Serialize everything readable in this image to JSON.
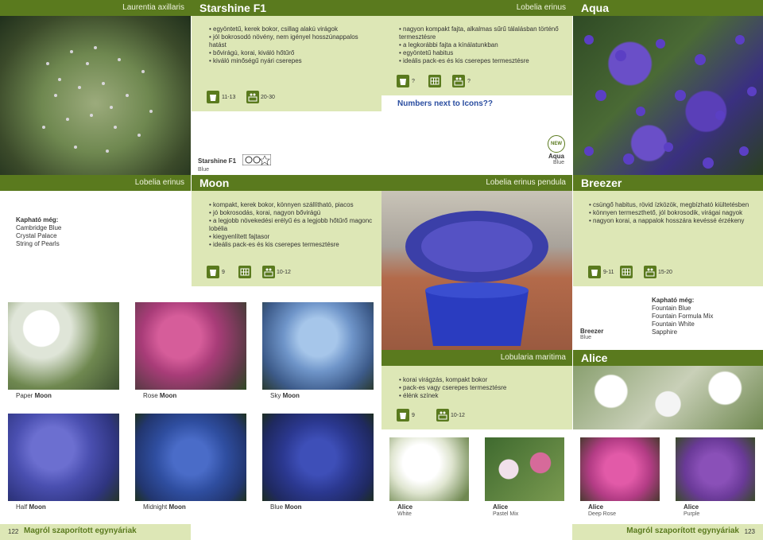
{
  "left_page": {
    "laurentia": {
      "sci": "Laurentia axillaris"
    },
    "starshine": {
      "name": "Starshine F1",
      "bullets": [
        "egyöntetű, kerek bokor, csillag alakú virágok",
        "jól bokrosodó növény, nem igényel hosszúnappalos hatást",
        "bővirágú, korai, kiváló hőtűrő",
        "kiváló minőségű nyári cserepes"
      ],
      "icon1_text": "11-13",
      "icon2_text": "20-30",
      "label_name": "Starshine F1",
      "label_color": "Blue"
    },
    "lobelia_left": {
      "sci": "Lobelia erinus"
    },
    "also": {
      "title": "Kapható még:",
      "items": [
        "Cambridge Blue",
        "Crystal Palace",
        "String of Pearls"
      ]
    },
    "moon": {
      "name": "Moon",
      "bullets": [
        "kompakt, kerek bokor, könnyen szállítható, piacos",
        "jó bokrosodás, korai, nagyon bővirágú",
        "a legjobb növekedési erélyű és a legjobb hőtűrő magonc lobélia",
        "kiegyenlített fajtasor",
        "ideális pack-es és kis cserepes termesztésre"
      ],
      "icon1_text": "9",
      "icon3_text": "10-12"
    },
    "photos": [
      {
        "prefix": "Paper ",
        "name": "Moon"
      },
      {
        "prefix": "Rose ",
        "name": "Moon"
      },
      {
        "prefix": "Sky ",
        "name": "Moon"
      },
      {
        "prefix": "Half ",
        "name": "Moon"
      },
      {
        "prefix": "Midnight ",
        "name": "Moon"
      },
      {
        "prefix": "Blue ",
        "name": "Moon"
      }
    ],
    "footer": {
      "page": "122",
      "title": "Magról szaporított egynyáriak"
    }
  },
  "right_page": {
    "aqua_intro": {
      "sci": "Lobelia erinus",
      "bullets": [
        "nagyon kompakt fajta, alkalmas sűrű tálalásban történő termesztésre",
        "a legkorábbi fajta a kínálatunkban",
        "egyöntetű habitus",
        "ideális pack-es és kis cserepes termesztésre"
      ],
      "q1": "?",
      "q2": "?",
      "note": "Numbers next to Icons??",
      "new_badge": "NEW",
      "label_name": "Aqua",
      "label_color": "Blue"
    },
    "aqua": {
      "name": "Aqua"
    },
    "pendula": {
      "sci": "Lobelia erinus pendula"
    },
    "breezer": {
      "name": "Breezer",
      "bullets": [
        "csüngő habitus, rövid ízközök, megbízható kiültetésben",
        "könnyen termeszthető, jól bokrosodik, virágai nagyok",
        "nagyon korai, a nappalok hosszára kevéssé érzékeny"
      ],
      "icon1_text": "9-11",
      "icon3_text": "15-20",
      "label_name": "Breezer",
      "label_color": "Blue",
      "also_title": "Kapható még:",
      "also_items": [
        "Fountain Blue",
        "Fountain Formula Mix",
        "Fountain White",
        "Sapphire"
      ]
    },
    "alice": {
      "sci": "Lobularia maritima",
      "name": "Alice",
      "bullets": [
        "korai virágzás, kompakt bokor",
        "pack-es vagy cserepes termesztésre",
        "élénk színek"
      ],
      "icon1_text": "9",
      "icon2_text": "10-12"
    },
    "alice_photos": [
      {
        "name": "Alice",
        "color": "White"
      },
      {
        "name": "Alice",
        "color": "Pastel Mix"
      },
      {
        "name": "Alice",
        "color": "Deep Rose"
      },
      {
        "name": "Alice",
        "color": "Purple"
      }
    ],
    "footer": {
      "page": "123",
      "title": "Magról szaporított egynyáriak"
    }
  },
  "colors": {
    "accent": "#5a7a1e",
    "light_green": "#dde7b6",
    "note_blue": "#2a4da0"
  },
  "icons": [
    "pot-icon",
    "tray-icon",
    "seed-tray-icon",
    "new-badge-icon"
  ]
}
